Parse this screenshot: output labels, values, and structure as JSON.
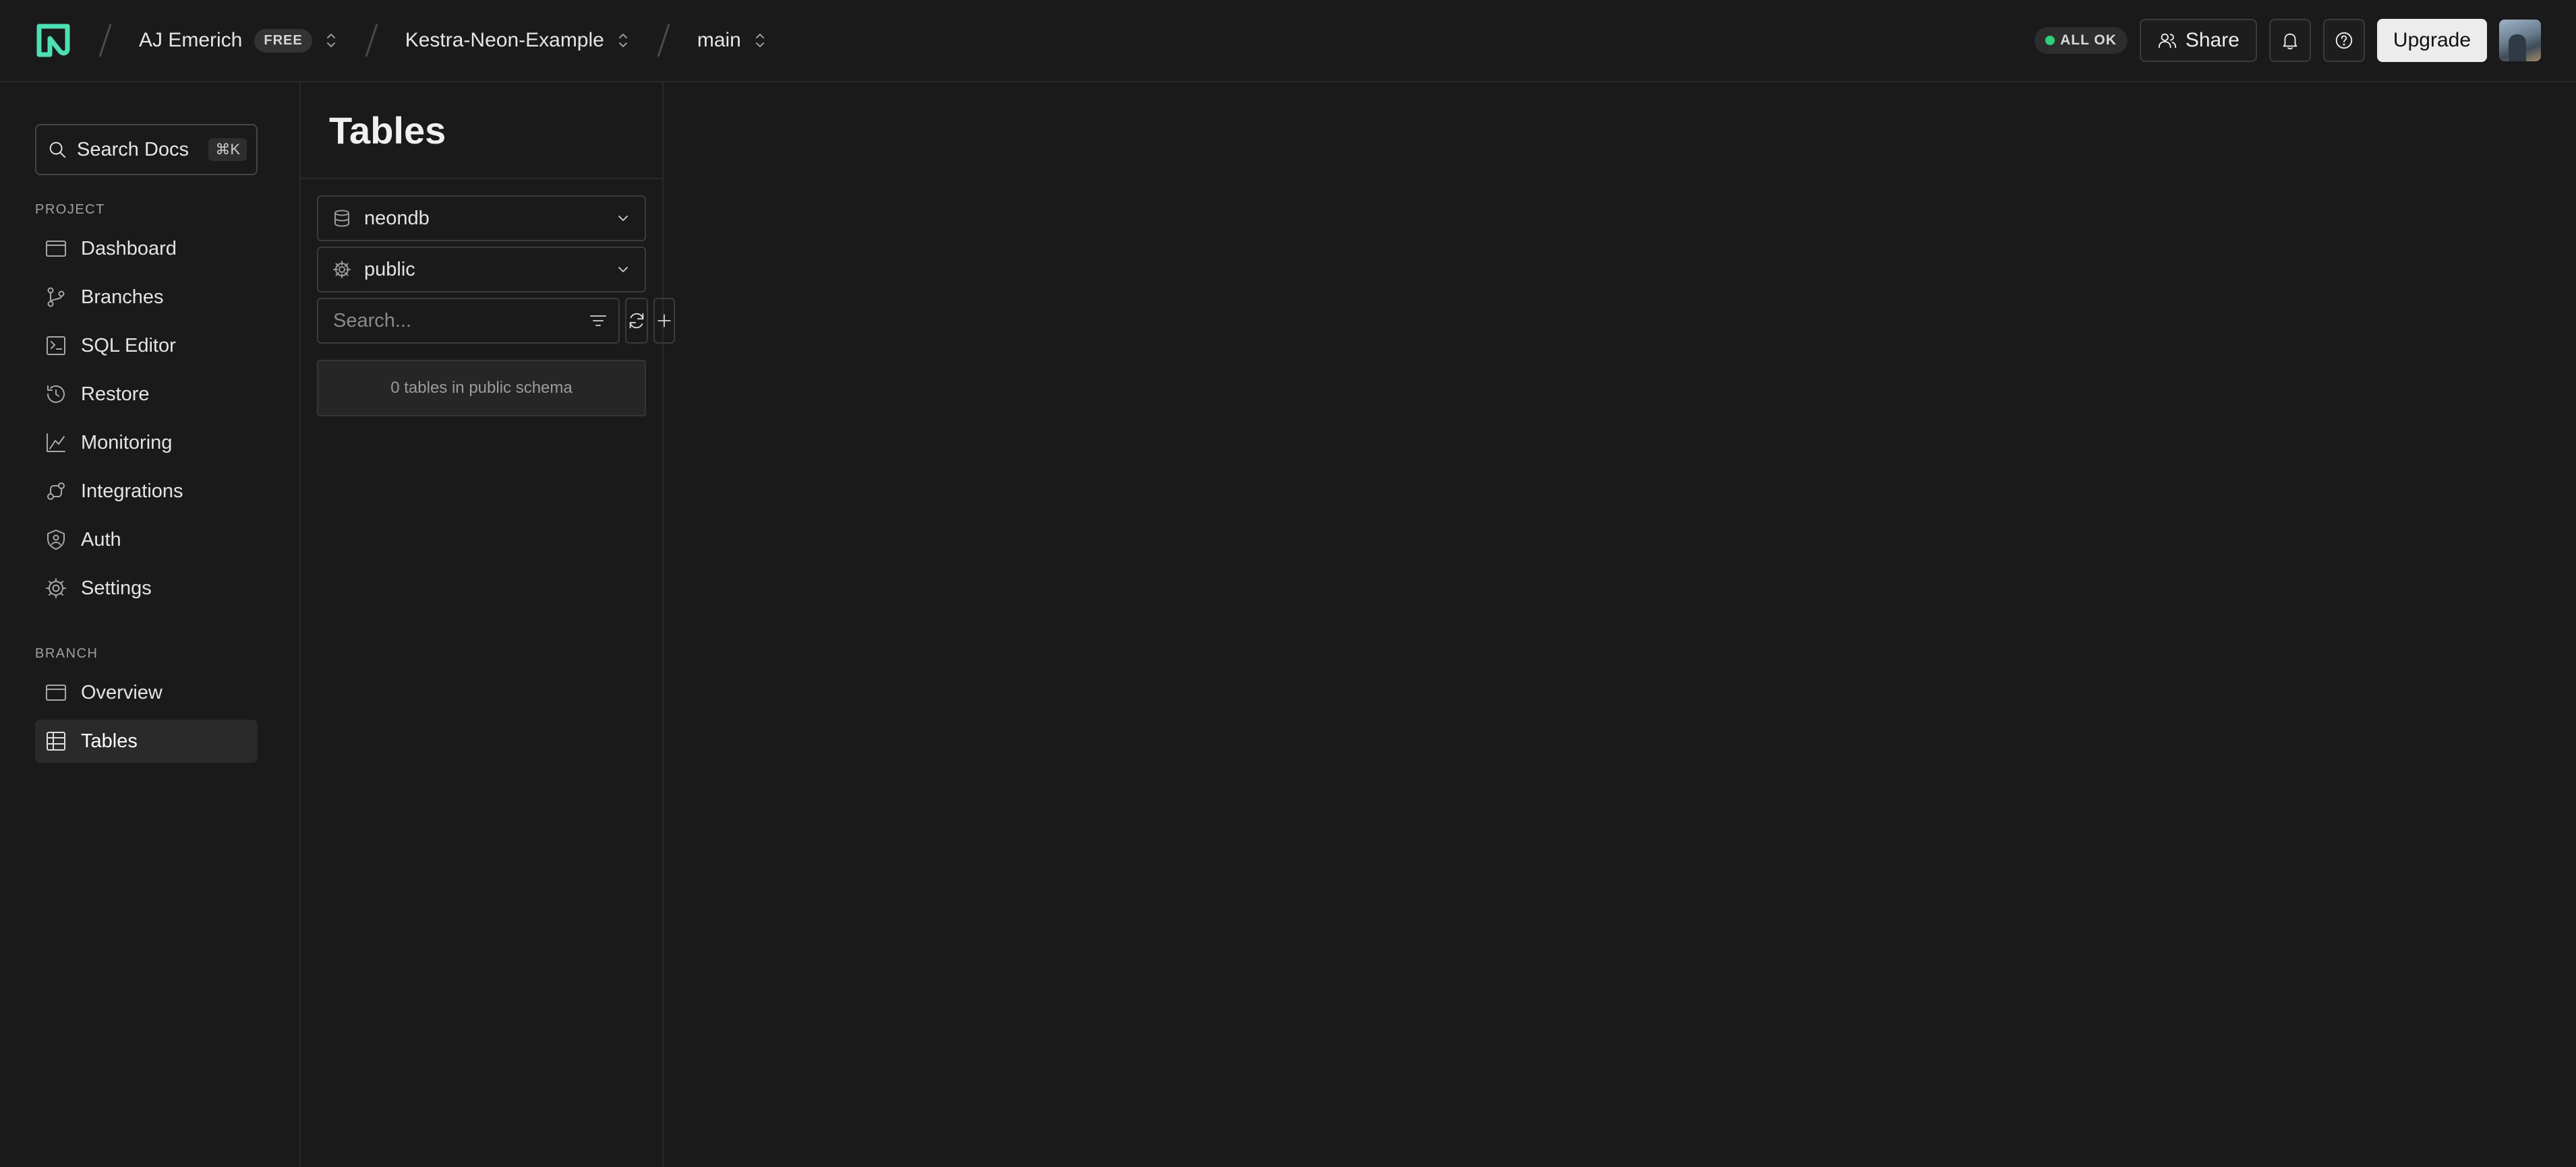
{
  "topbar": {
    "org_name": "AJ Emerich",
    "plan_badge": "FREE",
    "project_name": "Kestra-Neon-Example",
    "branch_name": "main",
    "status_text": "ALL OK",
    "status_color": "#2fd27a",
    "share_label": "Share",
    "upgrade_label": "Upgrade",
    "logo_color": "#4ce0b3"
  },
  "sidebar": {
    "search_label": "Search Docs",
    "search_shortcut": "⌘K",
    "project_section": "PROJECT",
    "project_items": [
      {
        "label": "Dashboard",
        "icon": "dashboard-icon"
      },
      {
        "label": "Branches",
        "icon": "branches-icon"
      },
      {
        "label": "SQL Editor",
        "icon": "sql-editor-icon"
      },
      {
        "label": "Restore",
        "icon": "restore-icon"
      },
      {
        "label": "Monitoring",
        "icon": "monitoring-icon"
      },
      {
        "label": "Integrations",
        "icon": "integrations-icon"
      },
      {
        "label": "Auth",
        "icon": "auth-icon"
      },
      {
        "label": "Settings",
        "icon": "settings-icon"
      }
    ],
    "branch_section": "BRANCH",
    "branch_items": [
      {
        "label": "Overview",
        "icon": "overview-icon"
      },
      {
        "label": "Tables",
        "icon": "tables-icon",
        "active": true
      }
    ]
  },
  "tables_panel": {
    "title": "Tables",
    "database_value": "neondb",
    "schema_value": "public",
    "search_placeholder": "Search...",
    "empty_message": "0 tables in public schema"
  }
}
